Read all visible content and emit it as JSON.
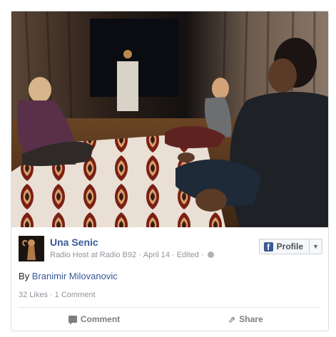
{
  "post": {
    "author_name": "Una Senic",
    "author_role": "Radio Host at Radio B92",
    "date": "April 14",
    "edited_label": "Edited",
    "profile_button_label": "Profile",
    "text_prefix": "By",
    "text_link": "Branimir Milovanovic",
    "likes": "32 Likes",
    "comments": "1 Comment"
  },
  "actions": {
    "comment_label": "Comment",
    "share_label": "Share"
  },
  "icons": {
    "brand": "facebook-icon",
    "privacy": "globe-icon",
    "dropdown": "chevron-down-icon",
    "comment": "comment-icon",
    "share": "share-icon"
  },
  "colors": {
    "link_blue": "#365899",
    "facebook_blue": "#3b5998",
    "meta_gray": "#90949c"
  }
}
